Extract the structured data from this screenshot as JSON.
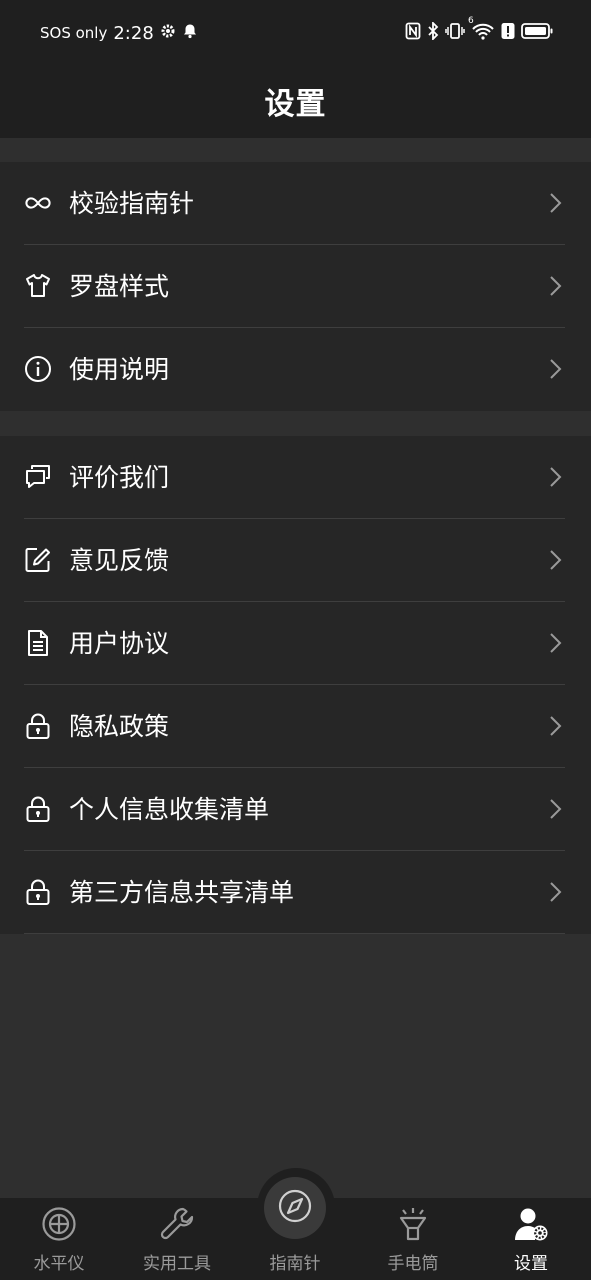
{
  "status_bar": {
    "carrier": "SOS only",
    "time": "2:28",
    "icons": [
      "gear-icon",
      "bell-icon",
      "nfc-icon",
      "bluetooth-icon",
      "vibrate-icon",
      "wifi-icon",
      "alert-icon",
      "battery-icon"
    ],
    "wifi_badge": "6"
  },
  "header": {
    "title": "设置"
  },
  "groups": [
    {
      "items": [
        {
          "icon": "infinity-icon",
          "label": "校验指南针"
        },
        {
          "icon": "tshirt-icon",
          "label": "罗盘样式"
        },
        {
          "icon": "info-icon",
          "label": "使用说明"
        }
      ]
    },
    {
      "items": [
        {
          "icon": "chat-icon",
          "label": "评价我们"
        },
        {
          "icon": "edit-icon",
          "label": "意见反馈"
        },
        {
          "icon": "document-icon",
          "label": "用户协议"
        },
        {
          "icon": "lock-icon",
          "label": "隐私政策"
        },
        {
          "icon": "lock-icon",
          "label": "个人信息收集清单"
        },
        {
          "icon": "lock-icon",
          "label": "第三方信息共享清单"
        }
      ]
    }
  ],
  "tabbar": {
    "tabs": [
      {
        "icon": "level-icon",
        "label": "水平仪",
        "active": false
      },
      {
        "icon": "wrench-icon",
        "label": "实用工具",
        "active": false
      },
      {
        "icon": "compass-icon",
        "label": "指南针",
        "active": false
      },
      {
        "icon": "flashlight-icon",
        "label": "手电筒",
        "active": false
      },
      {
        "icon": "user-settings-icon",
        "label": "设置",
        "active": true
      }
    ]
  },
  "colors": {
    "background": "#2f2f2f",
    "bar": "#1f1f1f",
    "group": "#262626",
    "divider": "#3e3e3e",
    "text": "#ffffff",
    "tab_inactive": "#9a9a9a"
  }
}
